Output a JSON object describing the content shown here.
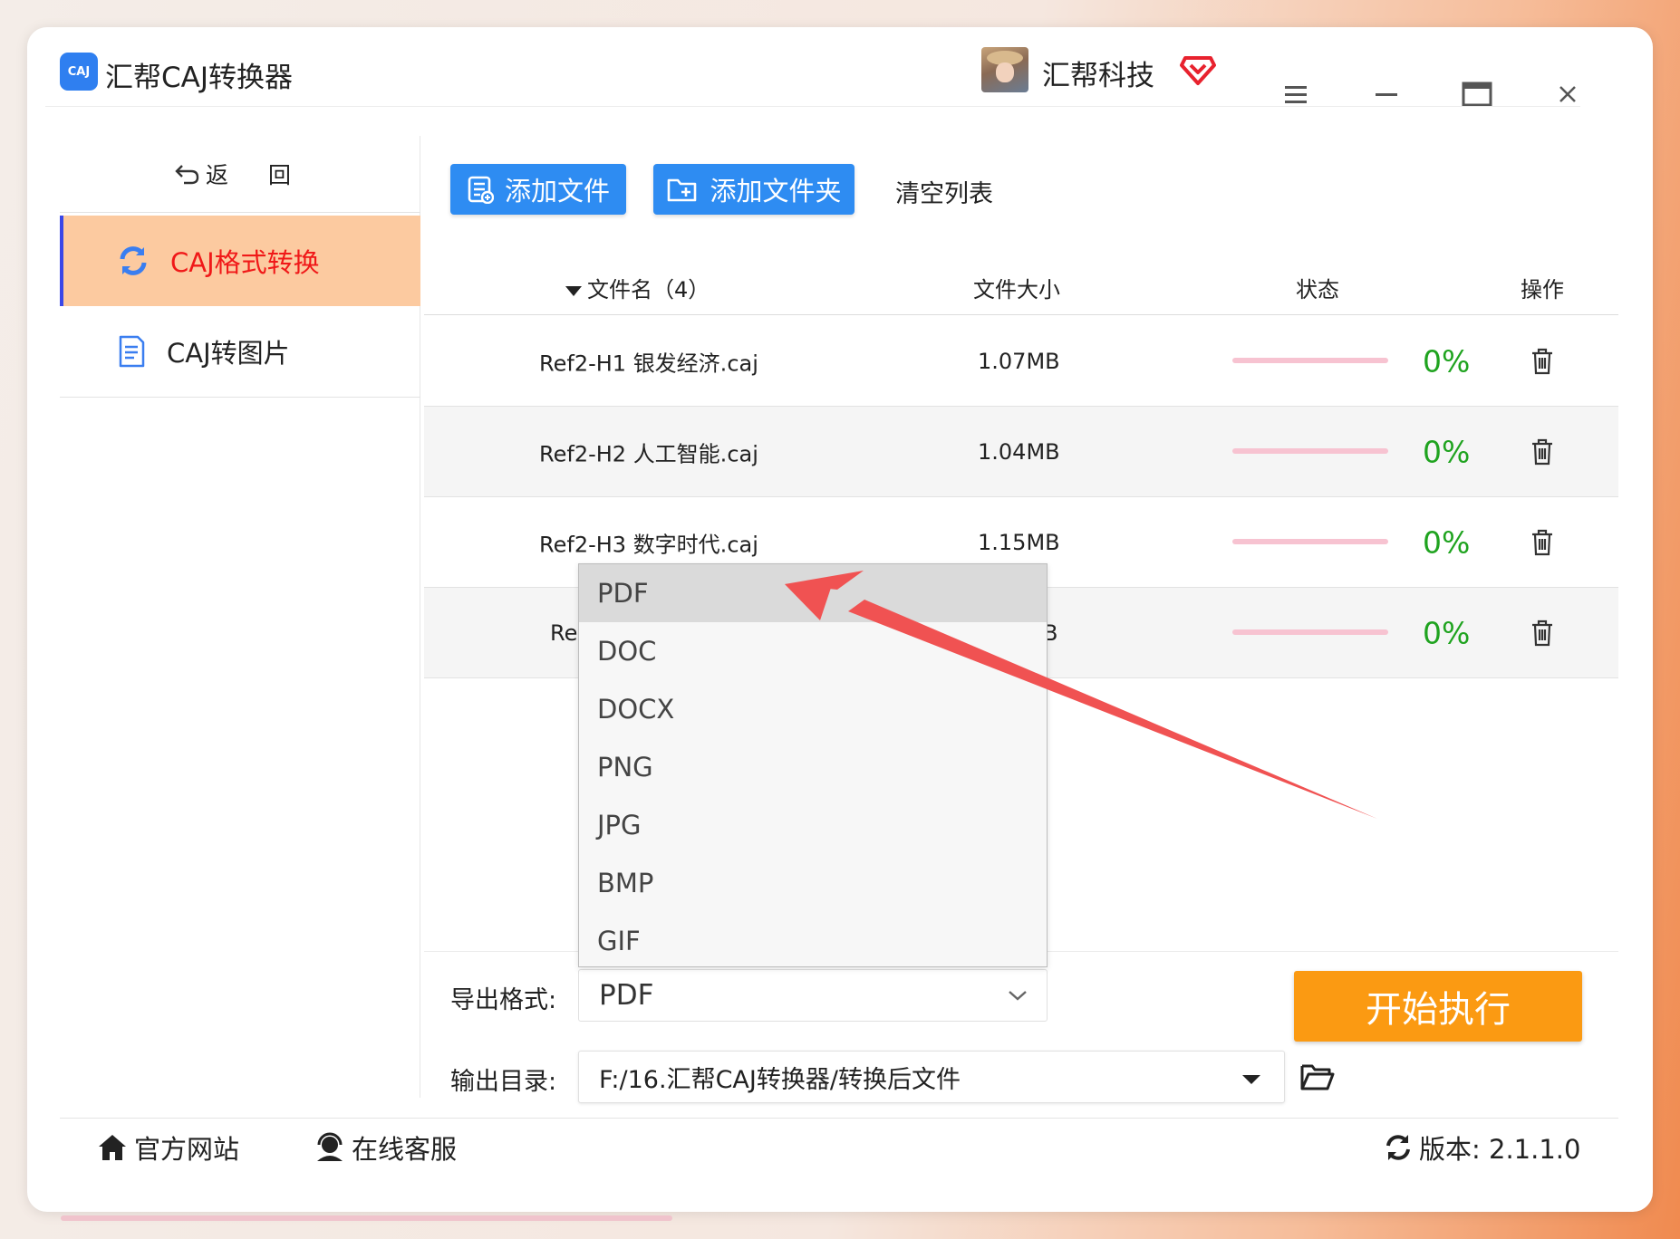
{
  "app": {
    "logo_text": "CAJ",
    "title": "汇帮CAJ转换器"
  },
  "user": {
    "name": "汇帮科技"
  },
  "sidebar": {
    "back_label": "返 回",
    "items": [
      {
        "label": "CAJ格式转换",
        "icon": "refresh-icon",
        "active": true
      },
      {
        "label": "CAJ转图片",
        "icon": "document-icon",
        "active": false
      }
    ]
  },
  "toolbar": {
    "add_file": "添加文件",
    "add_folder": "添加文件夹",
    "clear_list": "清空列表"
  },
  "table": {
    "headers": {
      "name": "文件名（4）",
      "size": "文件大小",
      "status": "状态",
      "action": "操作"
    },
    "rows": [
      {
        "name": "Ref2-H1 银发经济.caj",
        "size": "1.07MB",
        "progress": 0,
        "percent": "0%"
      },
      {
        "name": "Ref2-H2 人工智能.caj",
        "size": "1.04MB",
        "progress": 0,
        "percent": "0%"
      },
      {
        "name": "Ref2-H3 数字时代.caj",
        "size": "1.15MB",
        "progress": 0,
        "percent": "0%"
      },
      {
        "name": "Re",
        "size": "B",
        "progress": 0,
        "percent": "0%"
      }
    ]
  },
  "export": {
    "format_label": "导出格式:",
    "format_value": "PDF",
    "format_options": [
      "PDF",
      "DOC",
      "DOCX",
      "PNG",
      "JPG",
      "BMP",
      "GIF"
    ],
    "dir_label": "输出目录:",
    "dir_value": "F:/16.汇帮CAJ转换器/转换后文件"
  },
  "start_button": "开始执行",
  "footer": {
    "website": "官方网站",
    "support": "在线客服",
    "version": "版本:  2.1.1.0"
  },
  "colors": {
    "accent_blue": "#2e8cf2",
    "start_orange": "#fb9a12",
    "active_nav_bg": "#fccaa0",
    "active_nav_text": "#f01818",
    "percent_green": "#1fa31f",
    "annotation_arrow": "#f05252"
  }
}
